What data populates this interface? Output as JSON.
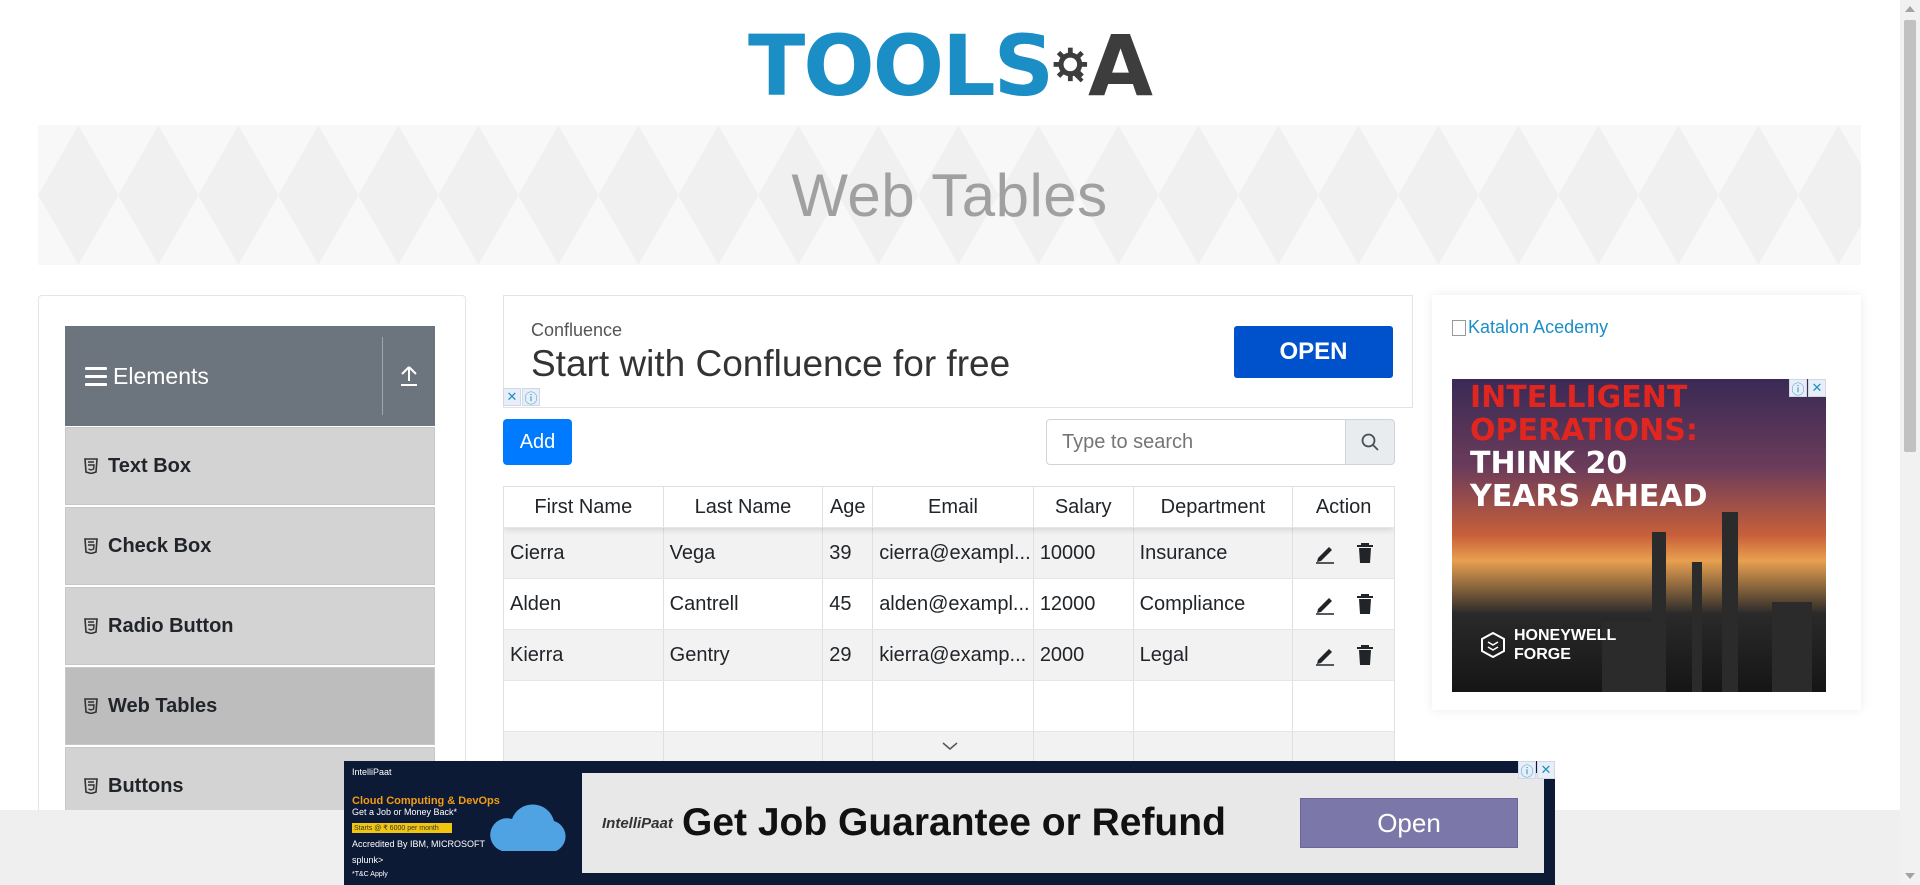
{
  "header": {
    "logo_primary": "TOOLS",
    "logo_secondary": "A"
  },
  "banner": {
    "title": "Web Tables"
  },
  "sidebar": {
    "group_title": "Elements",
    "items": [
      {
        "label": "Text Box"
      },
      {
        "label": "Check Box"
      },
      {
        "label": "Radio Button"
      },
      {
        "label": "Web Tables",
        "active": true
      },
      {
        "label": "Buttons"
      }
    ]
  },
  "top_ad": {
    "brand": "Confluence",
    "headline": "Start with Confluence for free",
    "cta": "OPEN"
  },
  "toolbar": {
    "add_label": "Add",
    "search_placeholder": "Type to search"
  },
  "table": {
    "columns": [
      "First Name",
      "Last Name",
      "Age",
      "Email",
      "Salary",
      "Department",
      "Action"
    ],
    "rows": [
      {
        "first": "Cierra",
        "last": "Vega",
        "age": "39",
        "email": "cierra@exampl...",
        "salary": "10000",
        "department": "Insurance"
      },
      {
        "first": "Alden",
        "last": "Cantrell",
        "age": "45",
        "email": "alden@exampl...",
        "salary": "12000",
        "department": "Compliance"
      },
      {
        "first": "Kierra",
        "last": "Gentry",
        "age": "29",
        "email": "kierra@examp...",
        "salary": "2000",
        "department": "Legal"
      }
    ]
  },
  "right_ad": {
    "link_text": "Katalon Acedemy",
    "headline_red": "INTELLIGENT OPERATIONS:",
    "headline_white": "THINK 20 YEARS AHEAD",
    "brand": "HONEYWELL FORGE"
  },
  "bottom_ad": {
    "brand": "IntelliPaat",
    "left_title": "Cloud Computing & DevOps",
    "left_sub": "Get a Job or Money Back*",
    "left_price": "Starts @ ₹ 6000 per month",
    "left_accredit": "Accredited By IBM, MICROSOFT",
    "left_partners": "splunk>",
    "left_note": "*T&C Apply",
    "message": "Get Job Guarantee or Refund",
    "cta": "Open"
  },
  "colors": {
    "accent": "#007bff",
    "sidebar_header": "#6c757d",
    "confluence_blue": "#0052cc",
    "logo_blue": "#1b8ec6"
  }
}
